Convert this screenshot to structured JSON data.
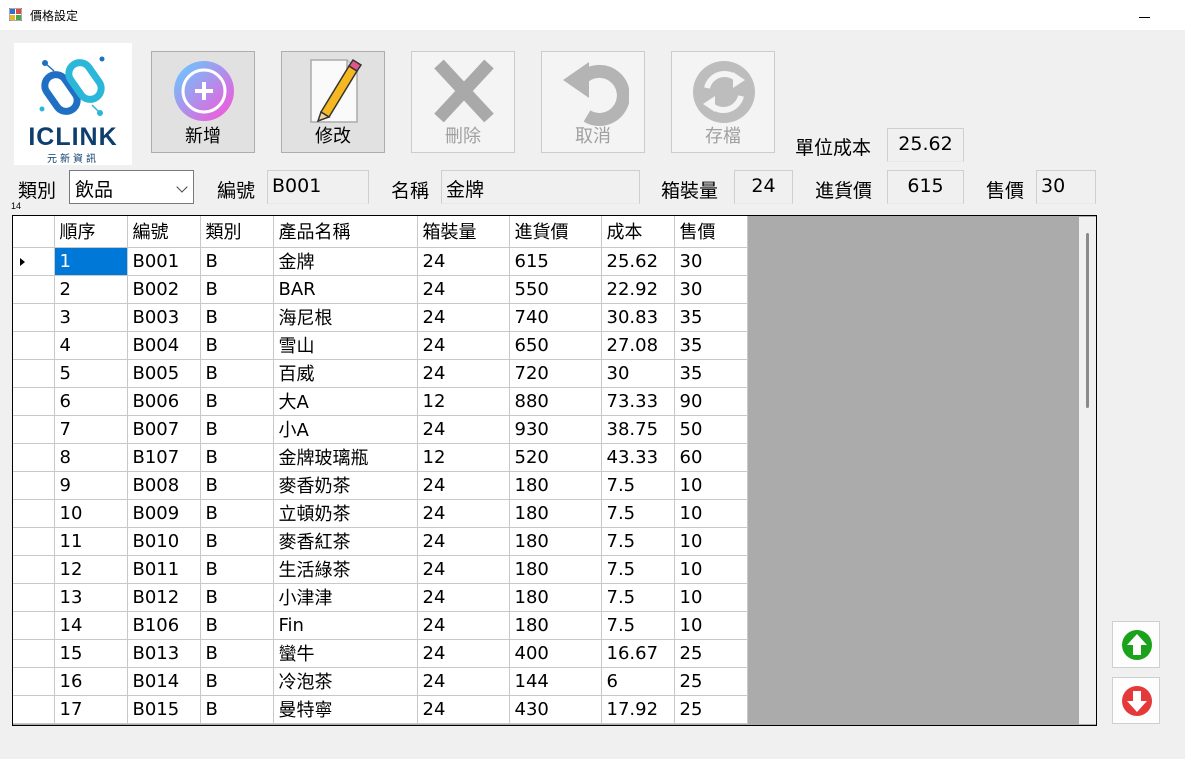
{
  "window": {
    "title": "價格設定"
  },
  "logo": {
    "brand": "ICLINK",
    "subtitle": "元新資訊"
  },
  "toolbar": {
    "add_label": "新增",
    "edit_label": "修改",
    "delete_label": "刪除",
    "cancel_label": "取消",
    "save_label": "存檔"
  },
  "form": {
    "unit_cost_label": "單位成本",
    "unit_cost_value": "25.62",
    "category_label": "類別",
    "category_value": "飲品",
    "code_label": "編號",
    "code_value": "B001",
    "name_label": "名稱",
    "name_value": "金牌",
    "pack_label": "箱裝量",
    "pack_value": "24",
    "purchase_label": "進貨價",
    "purchase_value": "615",
    "price_label": "售價",
    "price_value": "30",
    "row_count": "14"
  },
  "table": {
    "headers": [
      "順序",
      "編號",
      "類別",
      "產品名稱",
      "箱裝量",
      "進貨價",
      "成本",
      "售價"
    ],
    "rows": [
      [
        "1",
        "B001",
        "B",
        "金牌",
        "24",
        "615",
        "25.62",
        "30"
      ],
      [
        "2",
        "B002",
        "B",
        "BAR",
        "24",
        "550",
        "22.92",
        "30"
      ],
      [
        "3",
        "B003",
        "B",
        "海尼根",
        "24",
        "740",
        "30.83",
        "35"
      ],
      [
        "4",
        "B004",
        "B",
        "雪山",
        "24",
        "650",
        "27.08",
        "35"
      ],
      [
        "5",
        "B005",
        "B",
        "百威",
        "24",
        "720",
        "30",
        "35"
      ],
      [
        "6",
        "B006",
        "B",
        "大A",
        "12",
        "880",
        "73.33",
        "90"
      ],
      [
        "7",
        "B007",
        "B",
        "小A",
        "24",
        "930",
        "38.75",
        "50"
      ],
      [
        "8",
        "B107",
        "B",
        "金牌玻璃瓶",
        "12",
        "520",
        "43.33",
        "60"
      ],
      [
        "9",
        "B008",
        "B",
        "麥香奶茶",
        "24",
        "180",
        "7.5",
        "10"
      ],
      [
        "10",
        "B009",
        "B",
        "立頓奶茶",
        "24",
        "180",
        "7.5",
        "10"
      ],
      [
        "11",
        "B010",
        "B",
        "麥香紅茶",
        "24",
        "180",
        "7.5",
        "10"
      ],
      [
        "12",
        "B011",
        "B",
        "生活綠茶",
        "24",
        "180",
        "7.5",
        "10"
      ],
      [
        "13",
        "B012",
        "B",
        "小津津",
        "24",
        "180",
        "7.5",
        "10"
      ],
      [
        "14",
        "B106",
        "B",
        "Fin",
        "24",
        "180",
        "7.5",
        "10"
      ],
      [
        "15",
        "B013",
        "B",
        "蠻牛",
        "24",
        "400",
        "16.67",
        "25"
      ],
      [
        "16",
        "B014",
        "B",
        "冷泡茶",
        "24",
        "144",
        "6",
        "25"
      ],
      [
        "17",
        "B015",
        "B",
        "曼特寧",
        "24",
        "430",
        "17.92",
        "25"
      ]
    ]
  },
  "colors": {
    "selection": "#0078d7",
    "up": "#1aa31a",
    "down": "#e5383b"
  },
  "icons": [
    "app-icon",
    "plus-icon",
    "pencil-icon",
    "x-icon",
    "undo-icon",
    "refresh-icon",
    "arrow-up-icon",
    "arrow-down-icon"
  ]
}
